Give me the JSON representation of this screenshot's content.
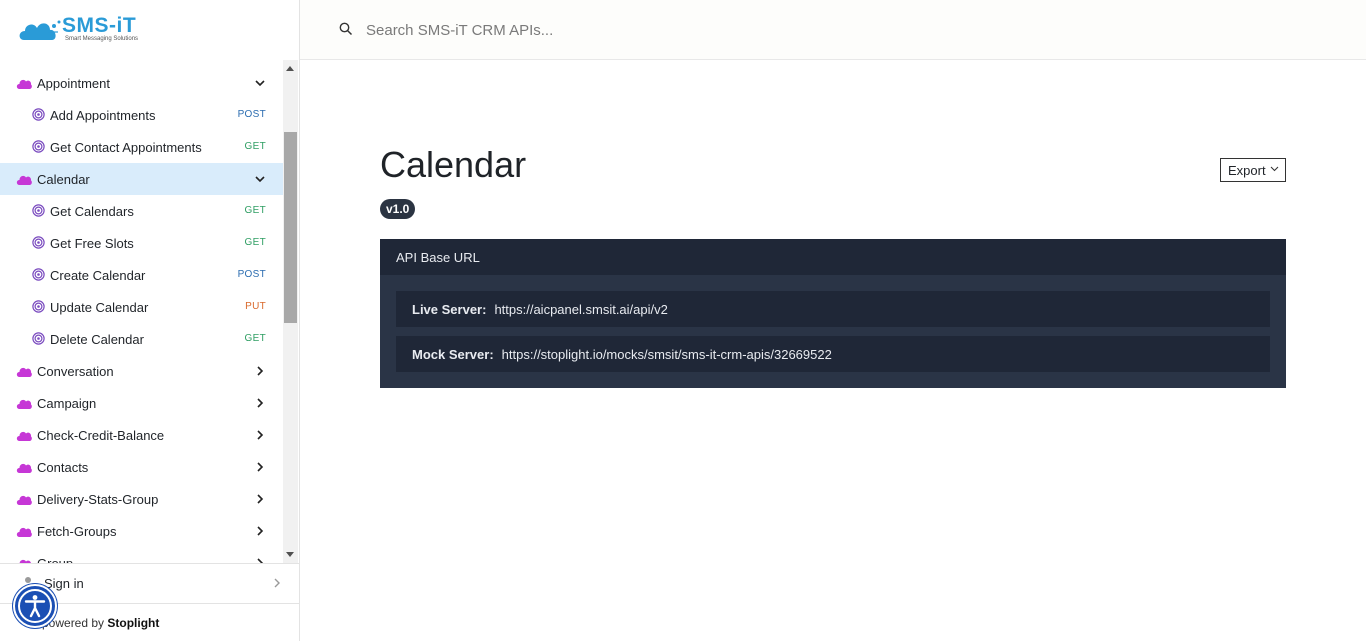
{
  "brand": {
    "name": "SMS-iT",
    "tagline": "Smart Messaging Solutions"
  },
  "search": {
    "placeholder": "Search SMS-iT CRM APIs..."
  },
  "sidebar": {
    "items": [
      {
        "kind": "group",
        "label": "Appointment",
        "expanded": true
      },
      {
        "kind": "endpoint",
        "label": "Add Appointments",
        "method": "POST"
      },
      {
        "kind": "endpoint",
        "label": "Get Contact Appointments",
        "method": "GET"
      },
      {
        "kind": "group",
        "label": "Calendar",
        "expanded": true,
        "active": true
      },
      {
        "kind": "endpoint",
        "label": "Get Calendars",
        "method": "GET"
      },
      {
        "kind": "endpoint",
        "label": "Get Free Slots",
        "method": "GET"
      },
      {
        "kind": "endpoint",
        "label": "Create Calendar",
        "method": "POST"
      },
      {
        "kind": "endpoint",
        "label": "Update Calendar",
        "method": "PUT"
      },
      {
        "kind": "endpoint",
        "label": "Delete Calendar",
        "method": "GET"
      },
      {
        "kind": "group",
        "label": "Conversation",
        "expanded": false
      },
      {
        "kind": "group",
        "label": "Campaign",
        "expanded": false
      },
      {
        "kind": "group",
        "label": "Check-Credit-Balance",
        "expanded": false
      },
      {
        "kind": "group",
        "label": "Contacts",
        "expanded": false
      },
      {
        "kind": "group",
        "label": "Delivery-Stats-Group",
        "expanded": false
      },
      {
        "kind": "group",
        "label": "Fetch-Groups",
        "expanded": false
      },
      {
        "kind": "group",
        "label": "Group",
        "expanded": false
      }
    ],
    "signin_label": "Sign in",
    "powered_prefix": "powered by ",
    "powered_brand": "Stoplight"
  },
  "main": {
    "title": "Calendar",
    "version": "v1.0",
    "export_label": "Export",
    "api_base_title": "API Base URL",
    "servers": [
      {
        "label": "Live Server:",
        "url": "https://aicpanel.smsit.ai/api/v2"
      },
      {
        "label": "Mock Server:",
        "url": "https://stoplight.io/mocks/smsit/sms-it-crm-apis/32669522"
      }
    ]
  },
  "colors": {
    "accent": "#d9ecfb",
    "group_icon": "#c637d6",
    "endpoint_icon": "#7a4bbf",
    "post": "#2b6cb0",
    "get": "#2f9e63",
    "put": "#d9692b",
    "api_panel": "#2a3446",
    "api_panel_dark": "#1f2737",
    "a11y_button": "#1b4fb4"
  },
  "icons": {
    "group": "cloud-icon",
    "endpoint": "target-icon",
    "search": "search-icon",
    "user": "person-icon",
    "accessibility": "accessibility-icon"
  }
}
